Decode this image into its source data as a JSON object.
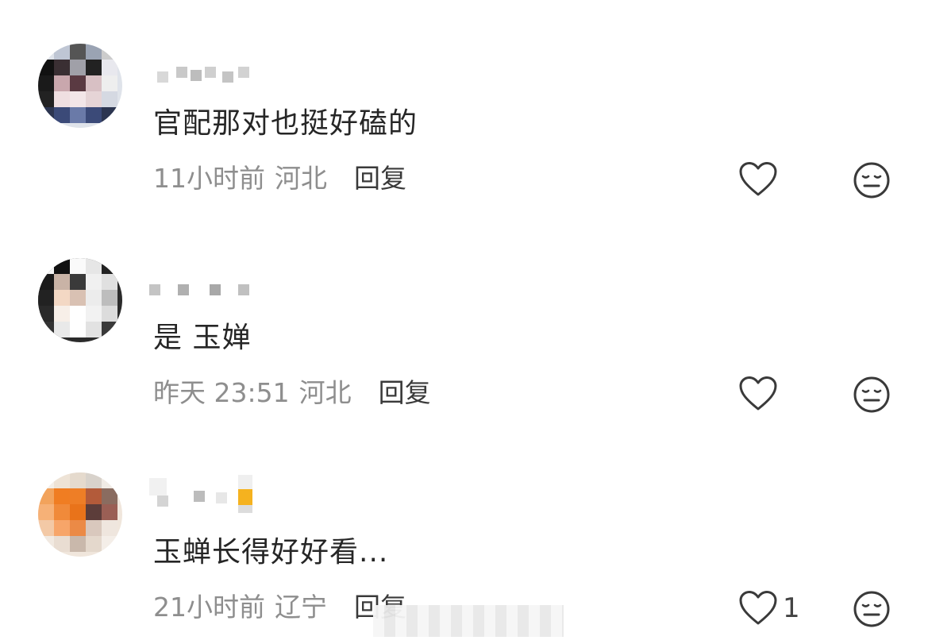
{
  "comments": [
    {
      "text": "官配那对也挺好磕的",
      "time": "11小时前",
      "location": "河北",
      "reply_label": "回复",
      "like_count": ""
    },
    {
      "text": "是 玉婵",
      "time": "昨天 23:51",
      "location": "河北",
      "reply_label": "回复",
      "like_count": ""
    },
    {
      "text": "玉蝉长得好好看...",
      "time": "21小时前",
      "location": "辽宁",
      "reply_label": "回复",
      "like_count": "1"
    }
  ],
  "icons": {
    "like": "heart-outline-icon",
    "dislike": "meh-face-icon"
  },
  "colors": {
    "text": "#262626",
    "meta": "#8e8e8e",
    "icon": "#3a3a3a",
    "background": "#ffffff"
  }
}
